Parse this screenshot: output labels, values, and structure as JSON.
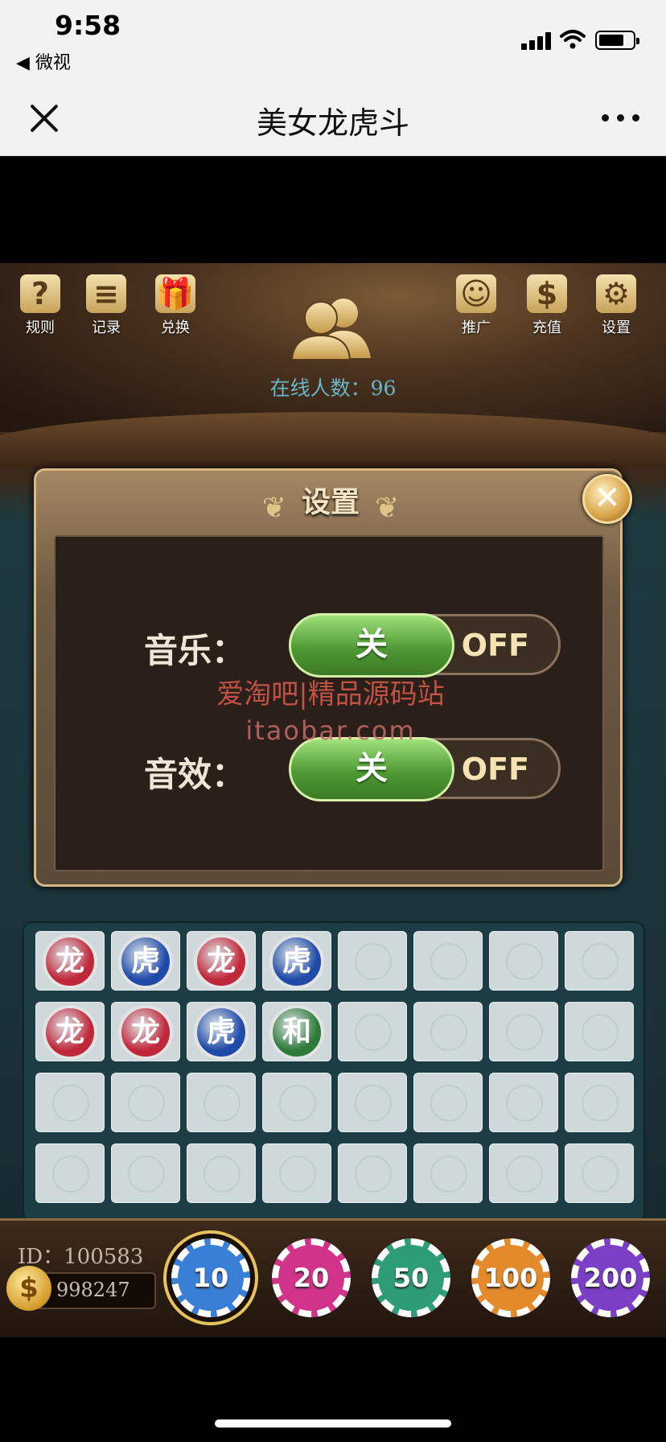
{
  "status_bar": {
    "time": "9:58",
    "back_app": "◀ 微视"
  },
  "header": {
    "title": "美女龙虎斗"
  },
  "top_icons_left": [
    {
      "glyph": "?",
      "label": "规则"
    },
    {
      "glyph": "≡",
      "label": "记录"
    },
    {
      "glyph": "🎁",
      "label": "兑换"
    }
  ],
  "top_icons_right": [
    {
      "glyph": "☺",
      "label": "推广"
    },
    {
      "glyph": "$",
      "label": "充值"
    },
    {
      "glyph": "⚙",
      "label": "设置"
    }
  ],
  "online": {
    "text": "在线人数：96"
  },
  "settings_dialog": {
    "title": "设置",
    "close_glyph": "✕",
    "music": {
      "label": "音乐：",
      "knob": "关",
      "state": "OFF"
    },
    "sfx": {
      "label": "音效：",
      "knob": "关",
      "state": "OFF"
    },
    "watermark_line1": "爱淘吧|精品源码站",
    "watermark_line2": "itaobar.com"
  },
  "results_grid": {
    "columns": 8,
    "rows": 4,
    "results": [
      [
        "龙",
        "龙"
      ],
      [
        "虎",
        "龙"
      ],
      [
        "龙",
        "虎"
      ],
      [
        "虎",
        "和"
      ]
    ]
  },
  "colors": {
    "dragon": "#c0273a",
    "tiger": "#1f4aa8",
    "tie": "#2e7a3a"
  },
  "player": {
    "id_text": "ID：100583",
    "coin_glyph": "$",
    "balance": "998247"
  },
  "chips": [
    {
      "value": "10",
      "color": "#3a7fd6",
      "selected": true
    },
    {
      "value": "20",
      "color": "#d2338a"
    },
    {
      "value": "50",
      "color": "#2f9c78"
    },
    {
      "value": "100",
      "color": "#e38a2a"
    },
    {
      "value": "200",
      "color": "#7b3fc6"
    }
  ]
}
